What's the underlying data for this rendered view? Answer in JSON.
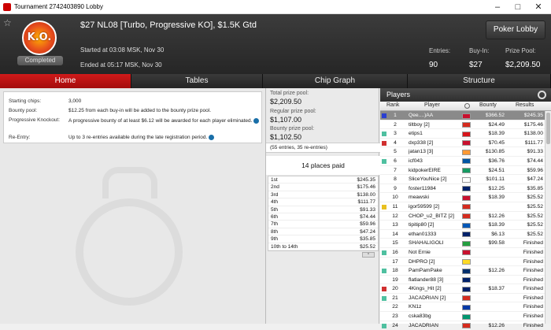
{
  "window": {
    "title": "Tournament 2742403890 Lobby",
    "minimize": "–",
    "maximize": "□",
    "close": "✕"
  },
  "header": {
    "star_icon": "☆",
    "badge": "K.O.",
    "status": "Completed",
    "name": "$27 NL08 [Turbo, Progressive KO], $1.5K Gtd",
    "started": "Started at 03:08 MSK, Nov 30",
    "ended": "Ended at 05:17 MSK, Nov 30",
    "entries_label": "Entries:",
    "entries": "90",
    "buyin_label": "Buy-In:",
    "buyin": "$27",
    "prizepool_label": "Prize Pool:",
    "prizepool": "$2,209.50",
    "lobby_button": "Poker Lobby"
  },
  "tabs": [
    "Home",
    "Tables",
    "Chip Graph",
    "Structure"
  ],
  "info": {
    "starting_chips_label": "Starting chips:",
    "starting_chips": "3,000",
    "bounty_pool_label": "Bounty pool:",
    "bounty_pool": "$12.25 from each buy-in will be added to the bounty prize pool.",
    "progressive_label": "Progressive Knockout:",
    "progressive": "A progressive bounty of at least $6.12 will be awarded for each player eliminated.",
    "reentry_label": "Re-Entry:",
    "reentry": "Up to 3 re-entries available during the late registration period."
  },
  "prize": {
    "total_label": "Total prize pool:",
    "total": "$2,209.50",
    "regular_label": "Regular prize pool:",
    "regular": "$1,107.00",
    "bounty_label": "Bounty prize pool:",
    "bounty": "$1,102.50",
    "entries_note": "(55 entries, 35 re-entries)",
    "places_paid": "14 places paid",
    "payouts": [
      {
        "place": "1st",
        "amount": "$245.35"
      },
      {
        "place": "2nd",
        "amount": "$175.46"
      },
      {
        "place": "3rd",
        "amount": "$138.00"
      },
      {
        "place": "4th",
        "amount": "$111.77"
      },
      {
        "place": "5th",
        "amount": "$91.33"
      },
      {
        "place": "6th",
        "amount": "$74.44"
      },
      {
        "place": "7th",
        "amount": "$59.96"
      },
      {
        "place": "8th",
        "amount": "$47.24"
      },
      {
        "place": "9th",
        "amount": "$35.85"
      },
      {
        "place": "10th to 14th",
        "amount": "$25.52"
      }
    ]
  },
  "players": {
    "title": "Players",
    "col_rank": "Rank",
    "col_player": "Player",
    "col_bounty": "Bounty",
    "col_results": "Results",
    "rows": [
      {
        "rank": "1",
        "name": "Qee....)AA",
        "bounty": "$366.52",
        "result": "$245.35",
        "sq": "#2a3fd0",
        "flag": "#c8102e",
        "sel": true
      },
      {
        "rank": "2",
        "name": "tiltboy [2]",
        "bounty": "$24.49",
        "result": "$175.46",
        "sq": "",
        "flag": "#d52b1e"
      },
      {
        "rank": "3",
        "name": "etips1",
        "bounty": "$18.39",
        "result": "$138.00",
        "sq": "#4fc0a0",
        "flag": "#d7141a"
      },
      {
        "rank": "4",
        "name": "dxp338 [2]",
        "bounty": "$70.45",
        "result": "$111.77",
        "sq": "#d03030",
        "flag": "#c8102e"
      },
      {
        "rank": "5",
        "name": "jatan13 [3]",
        "bounty": "$130.85",
        "result": "$91.33",
        "sq": "",
        "flag": "#ff9933"
      },
      {
        "rank": "6",
        "name": "icf043",
        "bounty": "$36.76",
        "result": "$74.44",
        "sq": "#4fc0a0",
        "flag": "#0055a4"
      },
      {
        "rank": "7",
        "name": "kidpokerEIRE",
        "bounty": "$24.51",
        "result": "$59.96",
        "sq": "",
        "flag": "#169b62"
      },
      {
        "rank": "8",
        "name": "SliceYouNice [2]",
        "bounty": "$101.11",
        "result": "$47.24",
        "sq": "",
        "flag": "#ffffff"
      },
      {
        "rank": "9",
        "name": "foster11984",
        "bounty": "$12.25",
        "result": "$35.85",
        "sq": "",
        "flag": "#012169"
      },
      {
        "rank": "10",
        "name": "meawski",
        "bounty": "$18.39",
        "result": "$25.52",
        "sq": "",
        "flag": "#c8102e"
      },
      {
        "rank": "11",
        "name": "igor59599 [2]",
        "bounty": "",
        "result": "$25.52",
        "sq": "#e8c020",
        "flag": "#d52b1e"
      },
      {
        "rank": "12",
        "name": "CHOP_u2_BITZ [2]",
        "bounty": "$12.26",
        "result": "$25.52",
        "sq": "",
        "flag": "#d52b1e"
      },
      {
        "rank": "13",
        "name": "tipitip80 [2]",
        "bounty": "$18.39",
        "result": "$25.52",
        "sq": "",
        "flag": "#0057b7"
      },
      {
        "rank": "14",
        "name": "ethan01333",
        "bounty": "$6.13",
        "result": "$25.52",
        "sq": "",
        "flag": "#012169"
      },
      {
        "rank": "15",
        "name": "SHAHALIGOLI",
        "bounty": "$99.58",
        "result": "Finished",
        "sq": "",
        "flag": "#239f40"
      },
      {
        "rank": "16",
        "name": "Not Ernie",
        "bounty": "",
        "result": "Finished",
        "sq": "#4fc0a0",
        "flag": "#c8102e"
      },
      {
        "rank": "17",
        "name": "DHPRO [2]",
        "bounty": "",
        "result": "Finished",
        "sq": "",
        "flag": "#fdda24"
      },
      {
        "rank": "18",
        "name": "PamPamPake",
        "bounty": "$12.26",
        "result": "Finished",
        "sq": "#4fc0a0",
        "flag": "#002f6c"
      },
      {
        "rank": "19",
        "name": "flatlander88 [3]",
        "bounty": "",
        "result": "Finished",
        "sq": "",
        "flag": "#012169"
      },
      {
        "rank": "20",
        "name": "4Kings_Hit [2]",
        "bounty": "$18.37",
        "result": "Finished",
        "sq": "#d03030",
        "flag": "#012169"
      },
      {
        "rank": "21",
        "name": "JACADRIAN [2]",
        "bounty": "",
        "result": "Finished",
        "sq": "#4fc0a0",
        "flag": "#d52b1e"
      },
      {
        "rank": "22",
        "name": "KN1z",
        "bounty": "",
        "result": "Finished",
        "sq": "",
        "flag": "#0039a6"
      },
      {
        "rank": "23",
        "name": "cska83bg",
        "bounty": "",
        "result": "Finished",
        "sq": "",
        "flag": "#00966e"
      },
      {
        "rank": "24",
        "name": "JACADRIAN",
        "bounty": "$12.26",
        "result": "Finished",
        "sq": "#4fc0a0",
        "flag": "#d52b1e"
      }
    ]
  }
}
